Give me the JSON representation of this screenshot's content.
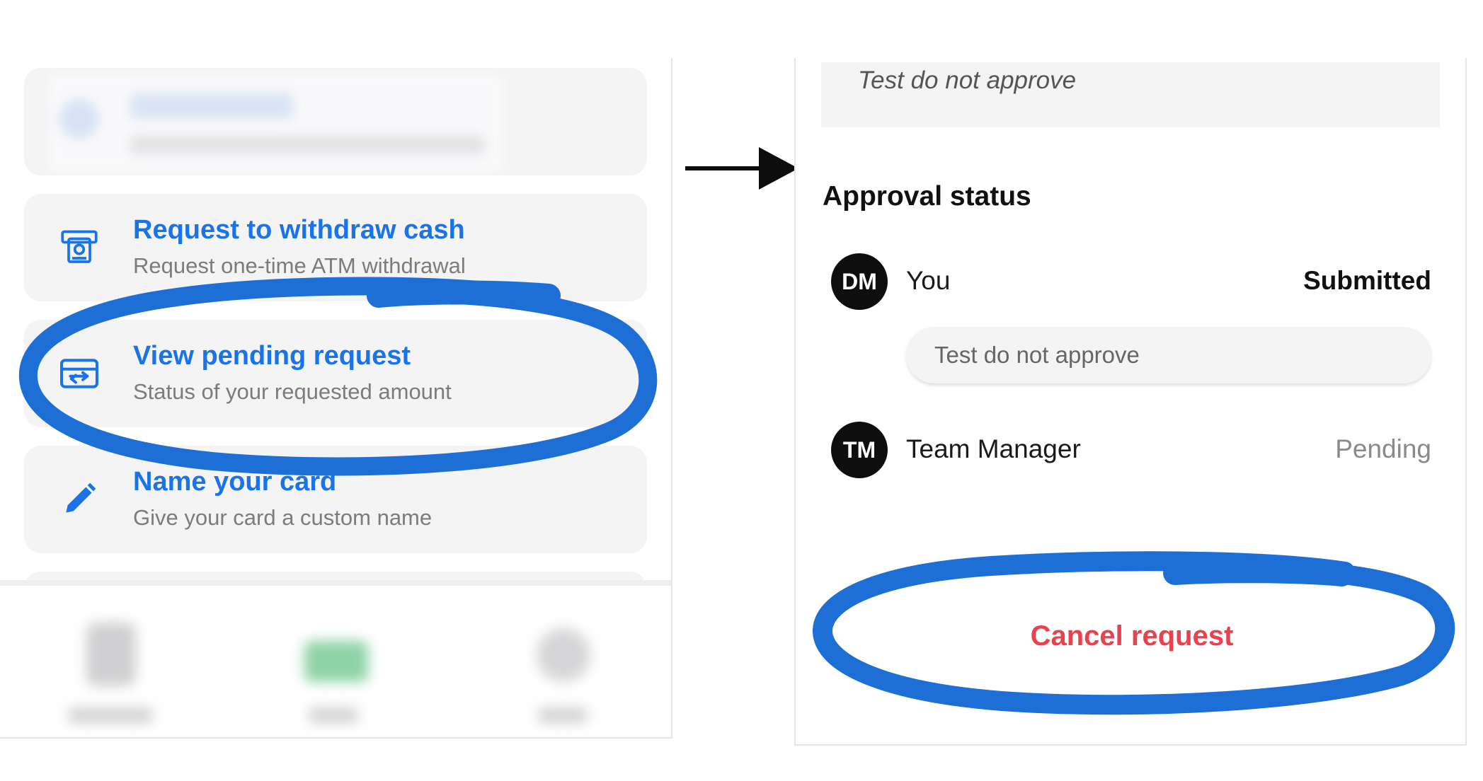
{
  "left_screen": {
    "menu_items": [
      {
        "title": "Request to withdraw cash",
        "subtitle": "Request one-time ATM withdrawal",
        "icon": "atm-icon"
      },
      {
        "title": "View pending request",
        "subtitle": "Status of your requested amount",
        "icon": "transfer-icon"
      },
      {
        "title": "Name your card",
        "subtitle": "Give your card a custom name",
        "icon": "pencil-icon"
      }
    ]
  },
  "right_screen": {
    "note_text": "Test do not approve",
    "section_title": "Approval status",
    "approvers": [
      {
        "initials": "DM",
        "name": "You",
        "status": "Submitted",
        "comment": "Test do not approve"
      },
      {
        "initials": "TM",
        "name": "Team Manager",
        "status": "Pending"
      }
    ],
    "cancel_label": "Cancel request"
  },
  "colors": {
    "accent_blue": "#1a73e8",
    "highlight_ring": "#1d6fd6",
    "cancel_red": "#e8424e",
    "card_bg": "#f4f4f5"
  }
}
